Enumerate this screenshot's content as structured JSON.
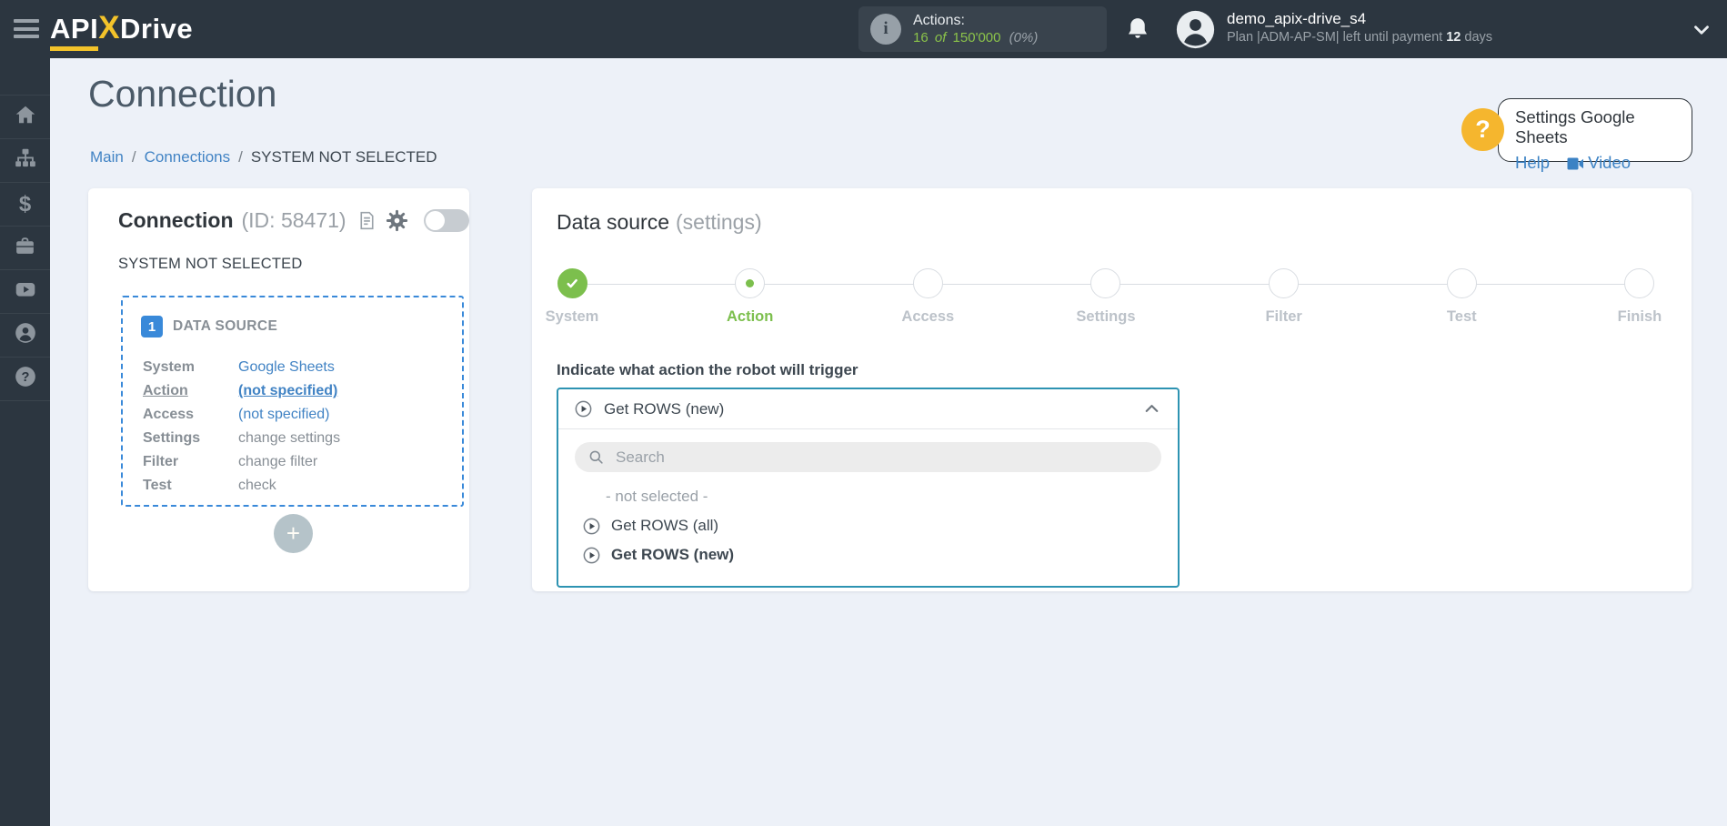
{
  "topbar": {
    "logo": {
      "part1": "API",
      "part2": "X",
      "part3": "Drive"
    },
    "actions": {
      "label": "Actions:",
      "used": "16",
      "of_word": "of",
      "total": "150'000",
      "percent": "(0%)"
    },
    "user": {
      "name": "demo_apix-drive_s4",
      "plan_prefix": "Plan |ADM-AP-SM| left until payment",
      "days_value": "12",
      "days_suffix": "days"
    }
  },
  "sidebar": {
    "items": [
      {
        "icon": "home-icon"
      },
      {
        "icon": "connections-icon"
      },
      {
        "icon": "billing-icon"
      },
      {
        "icon": "services-icon"
      },
      {
        "icon": "video-icon"
      },
      {
        "icon": "account-icon"
      },
      {
        "icon": "help-icon"
      }
    ]
  },
  "page": {
    "title": "Connection",
    "sep": "/",
    "breadcrumb": [
      "Main",
      "Connections",
      "SYSTEM NOT SELECTED"
    ],
    "help_card": {
      "title": "Settings Google Sheets",
      "help_link": "Help",
      "video_link": "Video",
      "bubble": "?"
    }
  },
  "connection_card": {
    "title": "Connection",
    "id_text": "(ID: 58471)",
    "subtitle": "SYSTEM NOT SELECTED",
    "block": {
      "number": "1",
      "title": "DATA SOURCE",
      "rows": [
        {
          "label": "System",
          "value": "Google Sheets"
        },
        {
          "label": "Action",
          "value": "(not specified)"
        },
        {
          "label": "Access",
          "value": "(not specified)"
        },
        {
          "label": "Settings",
          "value": "change settings"
        },
        {
          "label": "Filter",
          "value": "change filter"
        },
        {
          "label": "Test",
          "value": "check"
        }
      ]
    },
    "add_button": "+"
  },
  "settings_panel": {
    "title": "Data source",
    "title_suffix": "(settings)",
    "steps": [
      {
        "label": "System",
        "state": "done"
      },
      {
        "label": "Action",
        "state": "active"
      },
      {
        "label": "Access",
        "state": "todo"
      },
      {
        "label": "Settings",
        "state": "todo"
      },
      {
        "label": "Filter",
        "state": "todo"
      },
      {
        "label": "Test",
        "state": "todo"
      },
      {
        "label": "Finish",
        "state": "todo"
      }
    ],
    "question": "Indicate what action the robot will trigger",
    "dropdown": {
      "selected": "Get ROWS (new)",
      "search_placeholder": "Search",
      "options": [
        {
          "label": "- not selected -"
        },
        {
          "label": "Get ROWS (all)"
        },
        {
          "label": "Get ROWS (new)"
        }
      ]
    }
  },
  "colors": {
    "topbar_bg": "#2c3640",
    "page_bg": "#edf1f8",
    "accent_green": "#7cbf4d",
    "counter_green": "#8bc34a",
    "link_blue": "#4183c4",
    "dashed_blue": "#3989d9",
    "brand_yellow": "#f3c32a",
    "help_yellow": "#f5b62e",
    "dropdown_border": "#2d93b2"
  }
}
